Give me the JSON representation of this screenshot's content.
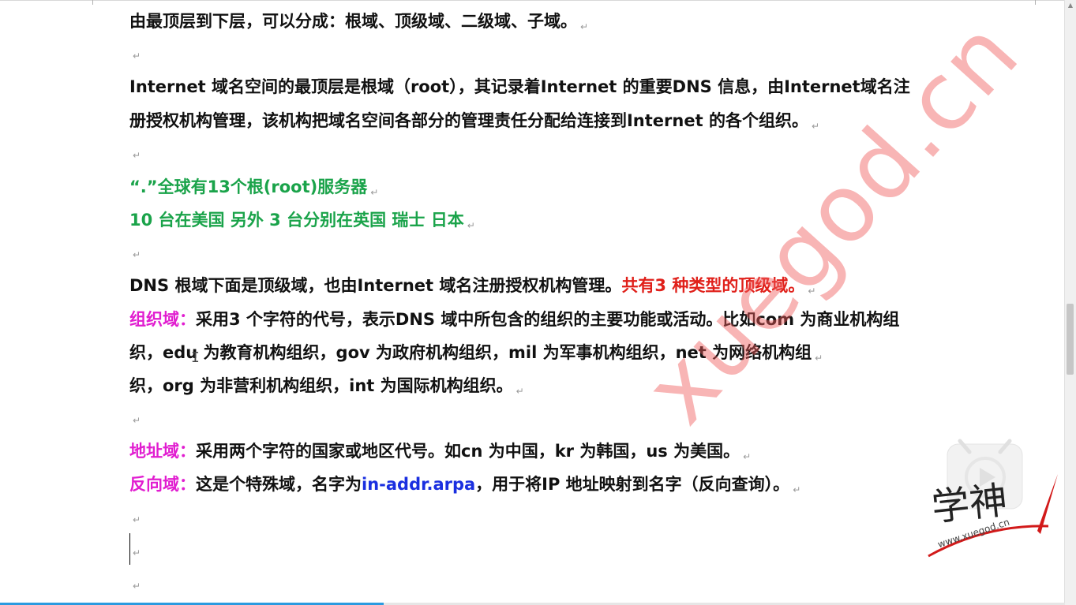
{
  "paragraph_mark": "↵",
  "lines": {
    "l1": "由最顶层到下层，可以分成：根域、顶级域、二级域、子域。",
    "l2": "Internet 域名空间的最顶层是根域（root），其记录着Internet 的重要DNS 信息，由Internet域名注",
    "l3": "册授权机构管理，该机构把域名空间各部分的管理责任分配给连接到Internet 的各个组织。",
    "l4": "“.”全球有13个根(root)服务器",
    "l5": "10 台在美国 另外 3 台分别在英国 瑞士 日本",
    "l6_a": "DNS 根域下面是顶级域，也由Internet 域名注册授权机构管理。",
    "l6_b": "共有3 种类型的顶级域。",
    "l7_a": "组织域：",
    "l7_b": "采用3 个字符的代号，表示DNS 域中所包含的组织的主要功能或活动。比如com 为商业机构组",
    "l8": "织，edu 为教育机构组织，gov 为政府机构组织，mil 为军事机构组织，net 为网络机构组",
    "l9": "织，org 为非营利机构组织，int 为国际机构组织。",
    "l10_a": "地址域：",
    "l10_b": "采用两个字符的国家或地区代号。如cn 为中国，kr 为韩国，us 为美国。",
    "l11_a": "反向域：",
    "l11_b": "这是个特殊域，名字为",
    "l11_c": "in-addr.arpa",
    "l11_d": "，用于将IP 地址映射到名字（反向查询）。"
  },
  "watermark": "xuegod.cn",
  "logo": {
    "text": "学神",
    "url": "www.xuegod.cn",
    "icon": "play-icon"
  },
  "video_progress": 0.36,
  "colors": {
    "green": "#1aa34a",
    "red": "#e0201a",
    "magenta": "#e11dd0",
    "blue": "#1a2fe0"
  }
}
